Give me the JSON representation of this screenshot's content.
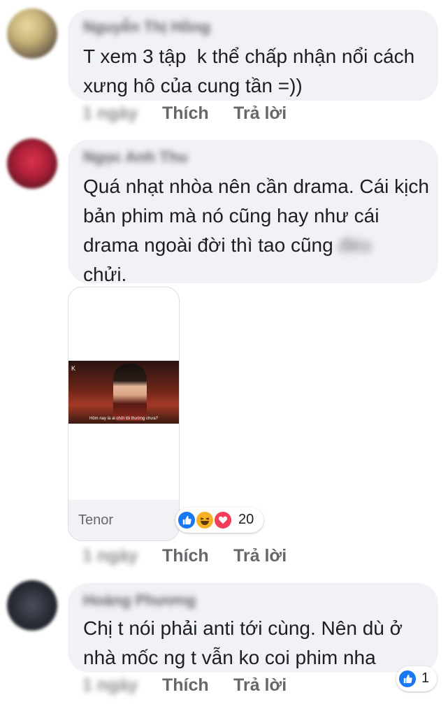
{
  "comments": [
    {
      "author": "Nguyễn Thị Hồng",
      "text": "T xem 3 tập  k thể chấp nhận nổi cách xưng hô của cung tần =))",
      "time": "1 ngày",
      "like_label": "Thích",
      "reply_label": "Trả lời"
    },
    {
      "author": "Ngọc Anh Thu",
      "text_main": "Quá nhạt nhòa nên cần drama. Cái kịch bản phim mà nó cũng hay như cái drama ngoài đời thì tao cũng ",
      "text_blurred": "đéo",
      "text_end": "chửi.",
      "time": "1 ngày",
      "like_label": "Thích",
      "reply_label": "Trả lời",
      "gif": {
        "source": "Tenor",
        "subtitle": "Hôm nay là ai chửi tôi thường chưa?",
        "logo": "K"
      },
      "reactions": {
        "icons": [
          "like-icon",
          "haha-icon",
          "love-icon"
        ],
        "count": "20"
      }
    },
    {
      "author": "Hoàng Phương",
      "text": "Chị t nói phải anti tới cùng. Nên dù ở nhà mốc ng t vẫn ko coi phim nha",
      "time": "1 ngày",
      "like_label": "Thích",
      "reply_label": "Trả lời",
      "reactions": {
        "icons": [
          "like-icon"
        ],
        "count": "1"
      }
    }
  ],
  "colors": {
    "bubble": "#f0f2f5",
    "secondary_text": "#65676b",
    "like_blue": "#1877f2",
    "love_red": "#f33e58",
    "haha_yellow": "#f7b125"
  }
}
